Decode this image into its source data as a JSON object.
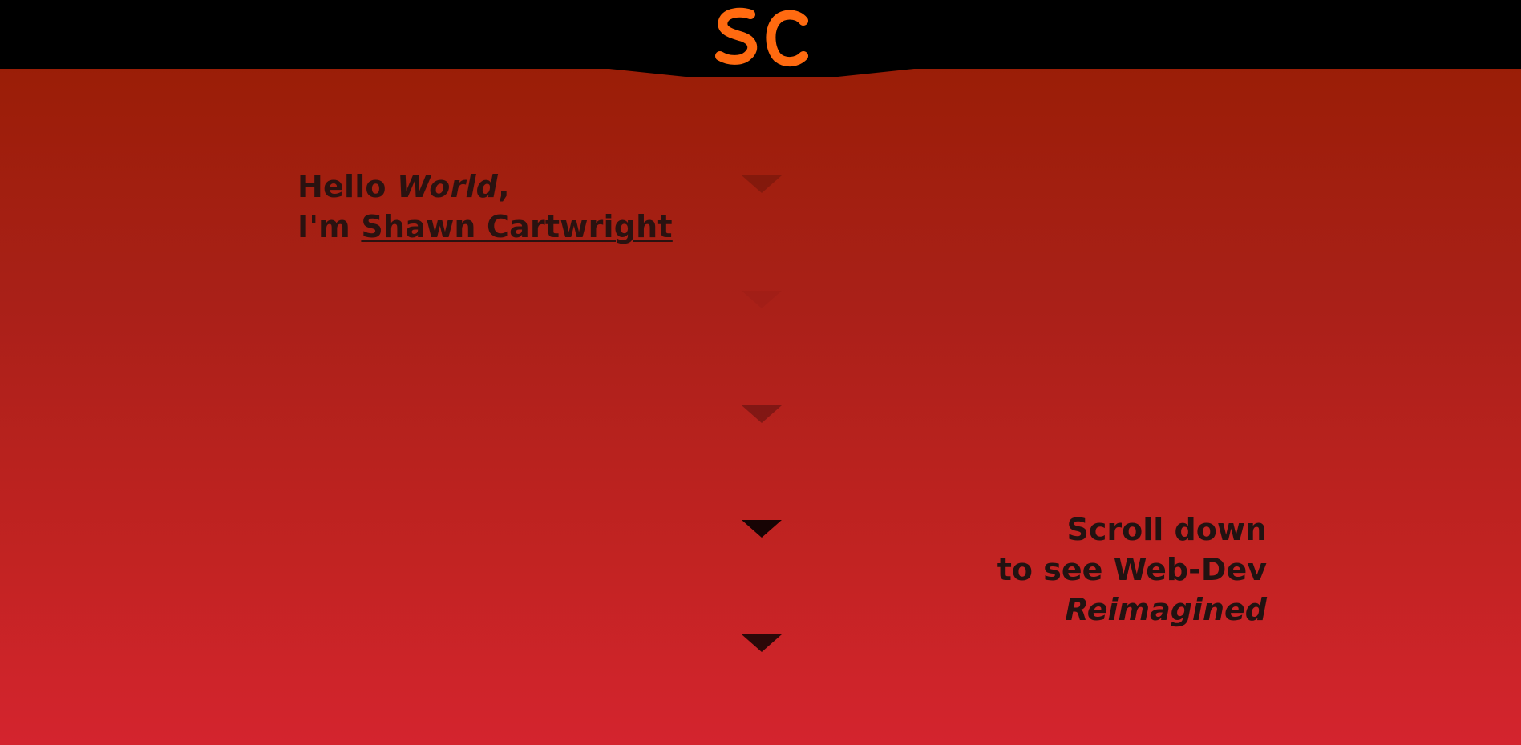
{
  "header": {
    "logo_text": "SC",
    "logo_color": "#ff6a10",
    "bar_color": "#000000"
  },
  "hero": {
    "line1_prefix": "Hello ",
    "line1_italic": "World",
    "line1_suffix": ",",
    "line2_prefix": "I'm ",
    "name_link": "Shawn Cartwright"
  },
  "scroll_note": {
    "line1": "Scroll down",
    "line2": "to see Web-Dev",
    "line3": "Reimagined"
  },
  "arrows": {
    "icon": "triangle-down-icon",
    "opacities": [
      0.18,
      0.04,
      0.28,
      0.88,
      0.78
    ]
  },
  "colors": {
    "gradient_top": "#961d02",
    "gradient_bottom": "#d4242e",
    "text": "#2a1210"
  }
}
